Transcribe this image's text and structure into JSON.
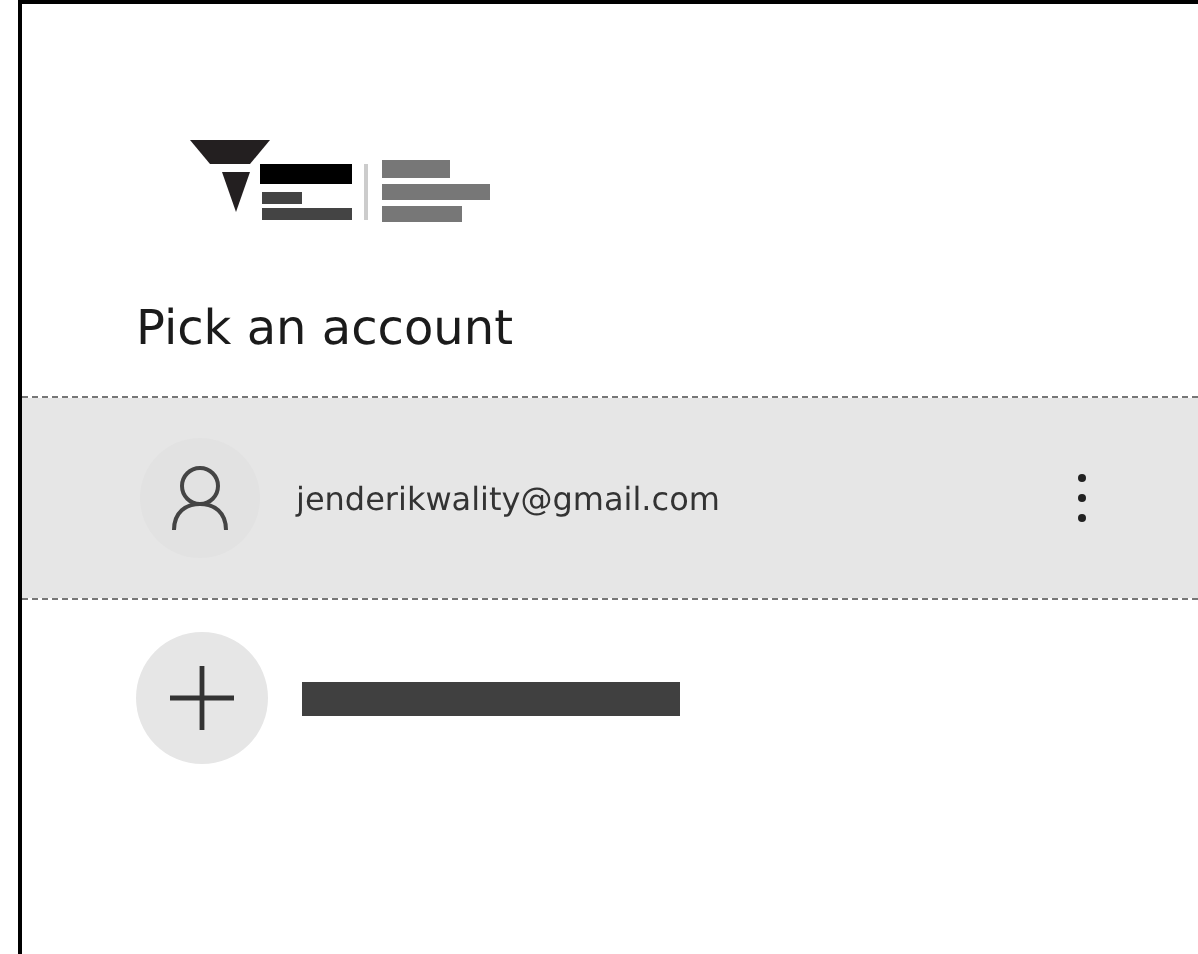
{
  "title": "Pick an account",
  "accounts": [
    {
      "email": "jenderikwality@gmail.com",
      "selected": true
    }
  ]
}
